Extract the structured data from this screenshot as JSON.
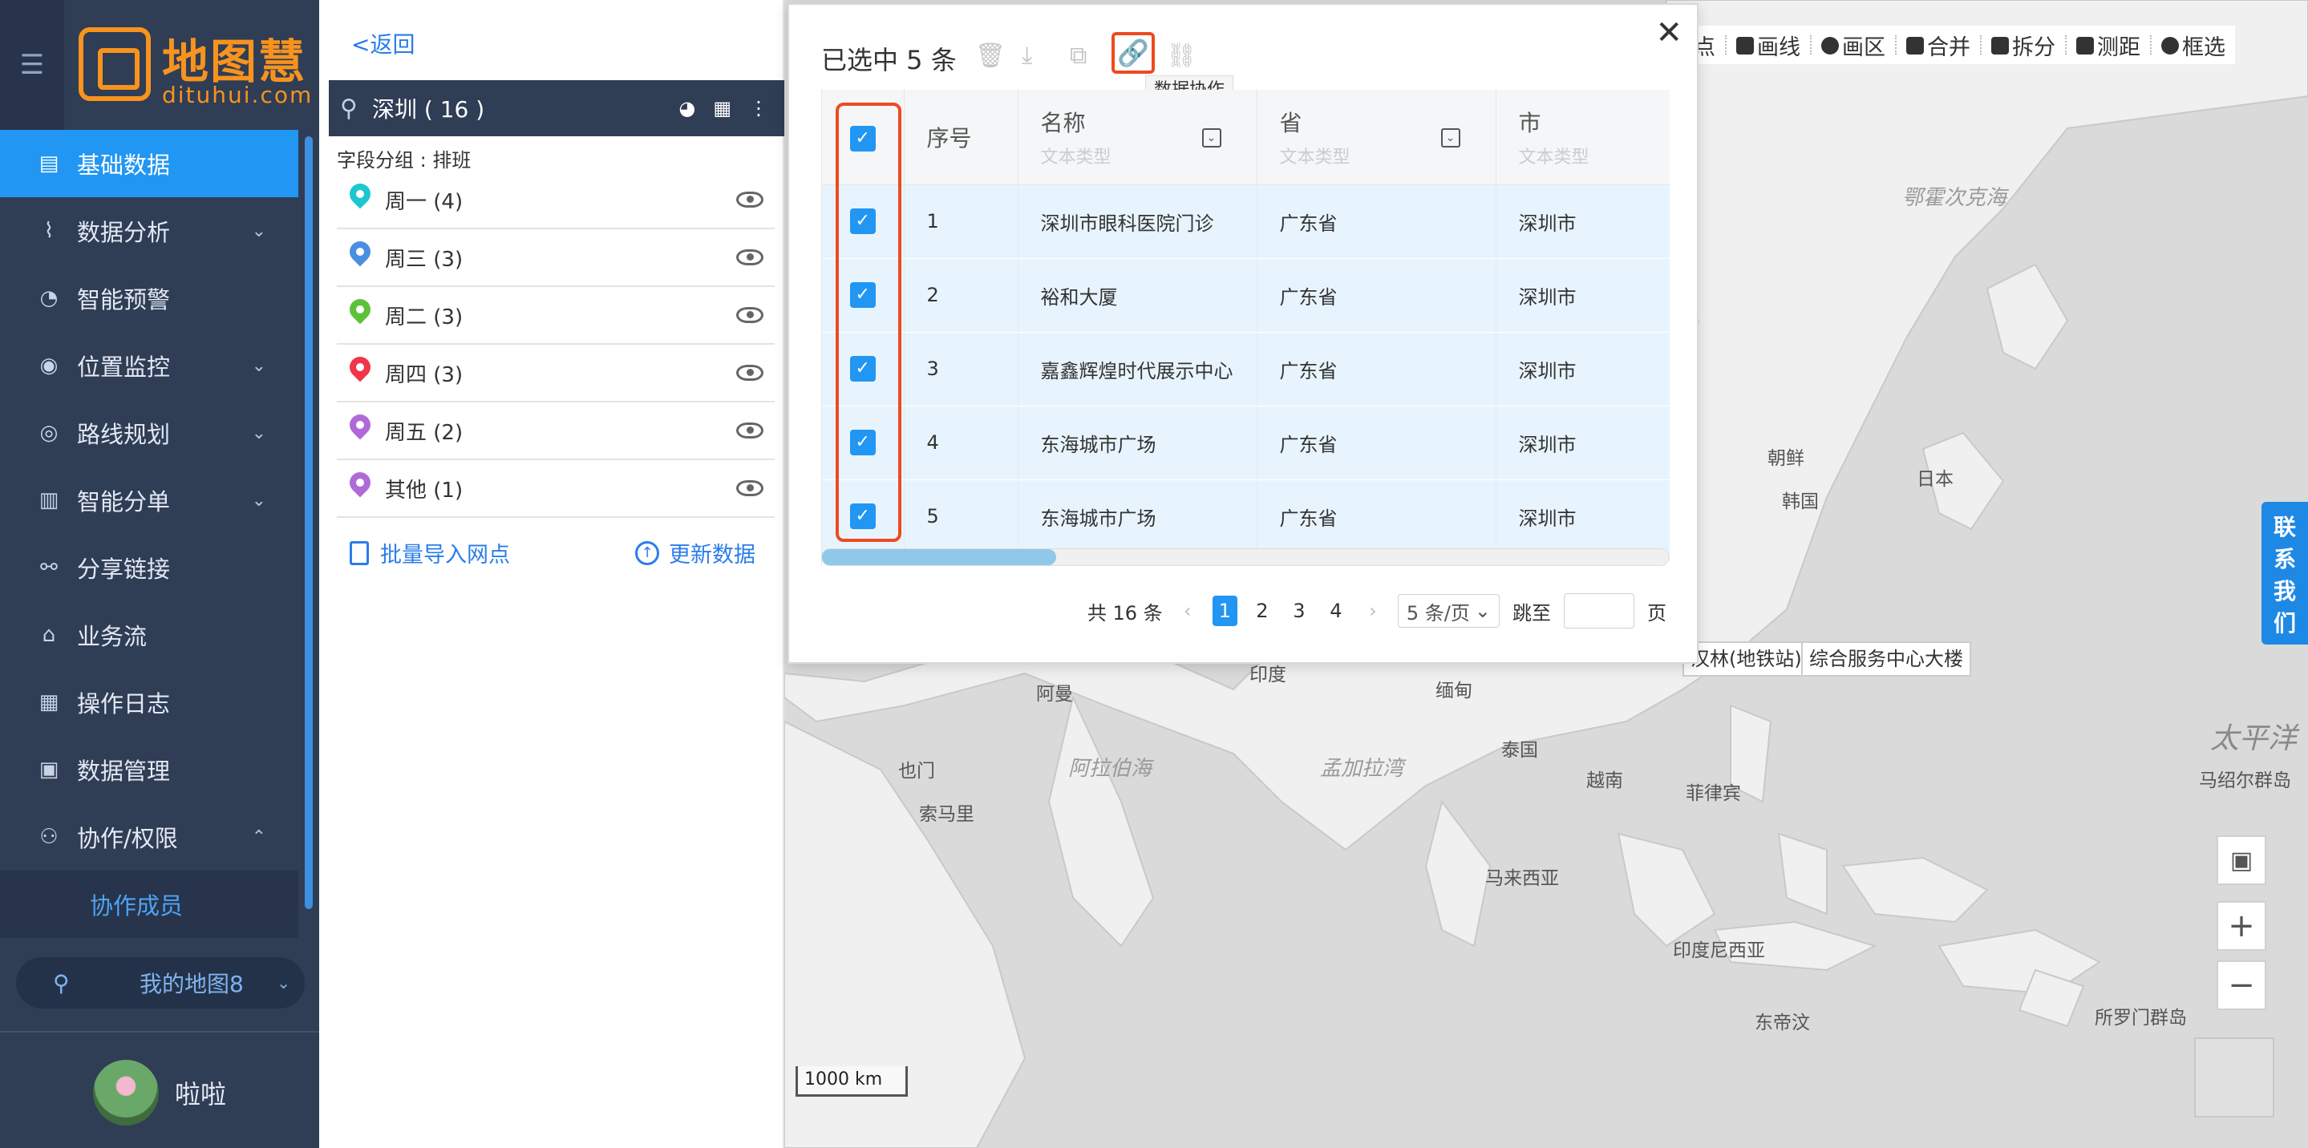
{
  "logo": {
    "cn": "地图慧",
    "en": "dituhui.com"
  },
  "nav": {
    "items": [
      {
        "label": "基础数据",
        "icon": "database-icon",
        "active": true,
        "chevron": false
      },
      {
        "label": "数据分析",
        "icon": "analysis-icon",
        "chevron": "down"
      },
      {
        "label": "智能预警",
        "icon": "alert-icon",
        "chevron": false
      },
      {
        "label": "位置监控",
        "icon": "location-icon",
        "chevron": "down"
      },
      {
        "label": "路线规划",
        "icon": "route-icon",
        "chevron": "down"
      },
      {
        "label": "智能分单",
        "icon": "order-split-icon",
        "chevron": "down"
      },
      {
        "label": "分享链接",
        "icon": "share-icon",
        "chevron": false
      },
      {
        "label": "业务流",
        "icon": "workflow-icon",
        "chevron": false
      },
      {
        "label": "操作日志",
        "icon": "calendar-icon",
        "chevron": false
      },
      {
        "label": "数据管理",
        "icon": "data-manage-icon",
        "chevron": false
      },
      {
        "label": "协作/权限",
        "icon": "team-icon",
        "chevron": "up"
      }
    ],
    "submenu": [
      {
        "label": "协作成员"
      }
    ],
    "my_map": "我的地图8",
    "user": "啦啦"
  },
  "panel": {
    "back": "<返回",
    "layer_name": "深圳 ( 16 )",
    "group_title": "字段分组 : 排班",
    "groups": [
      {
        "label": "周一 (4)",
        "color": "#1cc7d0"
      },
      {
        "label": "周三 (3)",
        "color": "#4a90e2"
      },
      {
        "label": "周二 (3)",
        "color": "#5cc23a"
      },
      {
        "label": "周四 (3)",
        "color": "#f0364a"
      },
      {
        "label": "周五 (2)",
        "color": "#b06ad8"
      },
      {
        "label": "其他 (1)",
        "color": "#b06ad8"
      }
    ],
    "bulk_import": "批量导入网点",
    "update_data": "更新数据"
  },
  "map": {
    "tools": [
      "点",
      "画线",
      "画区",
      "合并",
      "拆分",
      "测距",
      "框选"
    ],
    "labels": {
      "okhotsk": "鄂霍次克海",
      "korea_n": "朝鲜",
      "korea_s": "韩国",
      "japan": "日本",
      "pacific": "太平洋",
      "marshall": "马绍尔群岛",
      "india": "印度",
      "myanmar": "缅甸",
      "thailand": "泰国",
      "vietnam": "越南",
      "philippines": "菲律宾",
      "malaysia": "马来西亚",
      "indonesia": "印度尼西亚",
      "timor": "东帝汶",
      "solomon": "所罗门群岛",
      "oman": "阿曼",
      "yemen": "也门",
      "somalia": "索马里",
      "arabian_sea": "阿拉伯海",
      "bengal_bay": "孟加拉湾"
    },
    "poi_1": "汉林(地铁站)",
    "poi_2": "综合服务中心大楼",
    "contact": [
      "联",
      "系",
      "我",
      "们"
    ],
    "scale": "1000 km"
  },
  "modal": {
    "title": "已选中 5 条",
    "tooltip": "数据协作",
    "columns": [
      {
        "title": "序号"
      },
      {
        "title": "名称",
        "sub": "文本类型"
      },
      {
        "title": "省",
        "sub": "文本类型"
      },
      {
        "title": "市",
        "sub": "文本类型"
      }
    ],
    "rows": [
      {
        "idx": "1",
        "name": "深圳市眼科医院门诊",
        "province": "广东省",
        "city": "深圳市"
      },
      {
        "idx": "2",
        "name": "裕和大厦",
        "province": "广东省",
        "city": "深圳市"
      },
      {
        "idx": "3",
        "name": "嘉鑫辉煌时代展示中心",
        "province": "广东省",
        "city": "深圳市"
      },
      {
        "idx": "4",
        "name": "东海城市广场",
        "province": "广东省",
        "city": "深圳市"
      },
      {
        "idx": "5",
        "name": "东海城市广场",
        "province": "广东省",
        "city": "深圳市"
      }
    ],
    "pager": {
      "total": "共 16 条",
      "pages": [
        "1",
        "2",
        "3",
        "4"
      ],
      "current": "1",
      "page_size": "5 条/页",
      "jump_label": "跳至",
      "page_unit": "页"
    }
  },
  "colors": {
    "nav_bg": "#2f3d55",
    "accent": "#2196f3",
    "brand": "#f7931e",
    "highlight": "#ee4b1f"
  }
}
